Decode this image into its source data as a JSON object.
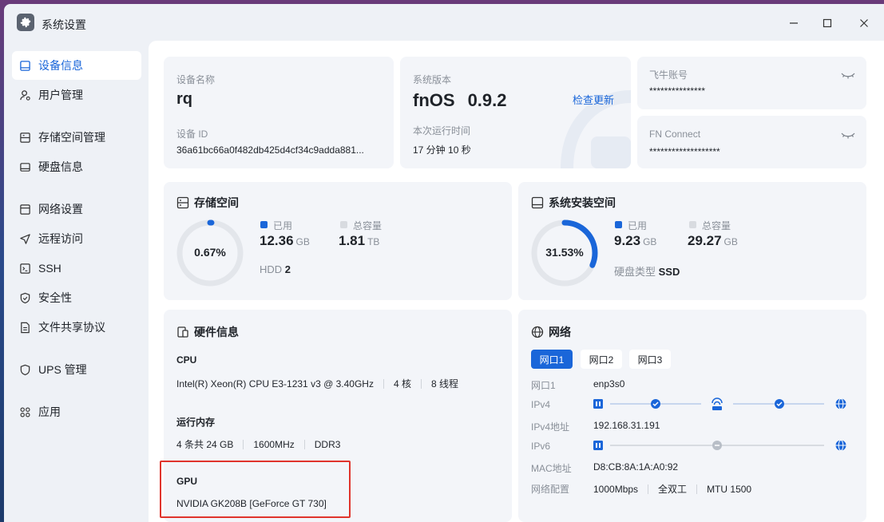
{
  "window": {
    "title": "系统设置"
  },
  "sidebar": {
    "items": [
      {
        "label": "设备信息",
        "icon": "device-icon"
      },
      {
        "label": "用户管理",
        "icon": "user-icon"
      },
      {
        "label": "存储空间管理",
        "icon": "storage-icon"
      },
      {
        "label": "硬盘信息",
        "icon": "disk-icon"
      },
      {
        "label": "网络设置",
        "icon": "network-icon"
      },
      {
        "label": "远程访问",
        "icon": "remote-icon"
      },
      {
        "label": "SSH",
        "icon": "terminal-icon"
      },
      {
        "label": "安全性",
        "icon": "shield-icon"
      },
      {
        "label": "文件共享协议",
        "icon": "file-icon"
      },
      {
        "label": "UPS 管理",
        "icon": "ups-icon"
      },
      {
        "label": "应用",
        "icon": "apps-icon"
      }
    ]
  },
  "device": {
    "name_label": "设备名称",
    "name": "rq",
    "id_label": "设备 ID",
    "id": "36a61bc66a0f482db425d4cf34c9adda881..."
  },
  "system": {
    "version_label": "系统版本",
    "os": "fnOS",
    "version": "0.9.2",
    "check_update": "检查更新",
    "uptime_label": "本次运行时间",
    "uptime": "17 分钟 10 秒"
  },
  "accounts": {
    "feiniu_label": "飞牛账号",
    "feiniu_value": "***************",
    "fnconnect_label": "FN Connect",
    "fnconnect_value": "*******************"
  },
  "storage": {
    "title": "存储空间",
    "percent_text": "0.67%",
    "percent": 0.67,
    "used_label": "已用",
    "used_value": "12.36",
    "used_unit": "GB",
    "total_label": "总容量",
    "total_value": "1.81",
    "total_unit": "TB",
    "type_label": "HDD",
    "type_value": "2"
  },
  "sysinstall": {
    "title": "系统安装空间",
    "percent_text": "31.53%",
    "percent": 31.53,
    "used_label": "已用",
    "used_value": "9.23",
    "used_unit": "GB",
    "total_label": "总容量",
    "total_value": "29.27",
    "total_unit": "GB",
    "disk_type_label": "硬盘类型",
    "disk_type_value": "SSD"
  },
  "hardware": {
    "title": "硬件信息",
    "cpu_label": "CPU",
    "cpu_model": "Intel(R) Xeon(R) CPU E3-1231 v3 @ 3.40GHz",
    "cpu_cores": "4 核",
    "cpu_threads": "8 线程",
    "mem_label": "运行内存",
    "mem_size": "4 条共 24 GB",
    "mem_speed": "1600MHz",
    "mem_type": "DDR3",
    "gpu_label": "GPU",
    "gpu_model": "NVIDIA GK208B [GeForce GT 730]"
  },
  "network": {
    "title": "网络",
    "tabs": [
      "网口1",
      "网口2",
      "网口3"
    ],
    "rows": {
      "port_label": "网口1",
      "port_value": "enp3s0",
      "ipv4_label": "IPv4",
      "ipv4addr_label": "IPv4地址",
      "ipv4addr_value": "192.168.31.191",
      "ipv6_label": "IPv6",
      "mac_label": "MAC地址",
      "mac_value": "D8:CB:8A:1A:A0:92",
      "config_label": "网络配置",
      "speed": "1000Mbps",
      "duplex": "全双工",
      "mtu": "MTU 1500"
    }
  },
  "colors": {
    "accent": "#1a66d9",
    "ring_bg": "#e3e6eb",
    "card_bg": "#f3f5f9",
    "highlight": "#e0342c"
  }
}
